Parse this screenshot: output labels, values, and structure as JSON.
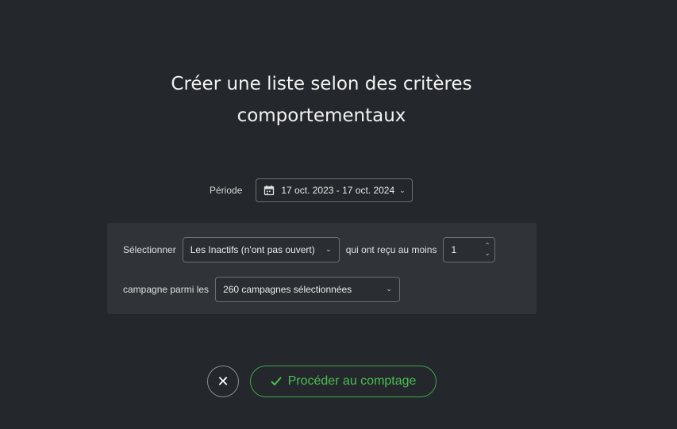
{
  "header": {
    "title_line1": "Créer une liste selon des critères",
    "title_line2": "comportementaux"
  },
  "period": {
    "label": "Période",
    "range": "17 oct. 2023 - 17 oct. 2024",
    "icon": "calendar-icon"
  },
  "criteria": {
    "select_label": "Sélectionner",
    "segment_value": "Les Inactifs (n'ont pas ouvert)",
    "received_label": "qui ont reçu au moins",
    "count_value": "1",
    "campaign_label": "campagne parmi les",
    "campaigns_value": "260 campagnes sélectionnées"
  },
  "actions": {
    "close_symbol": "✕",
    "proceed_label": "Procéder au comptage",
    "proceed_color": "#4cbd56"
  }
}
